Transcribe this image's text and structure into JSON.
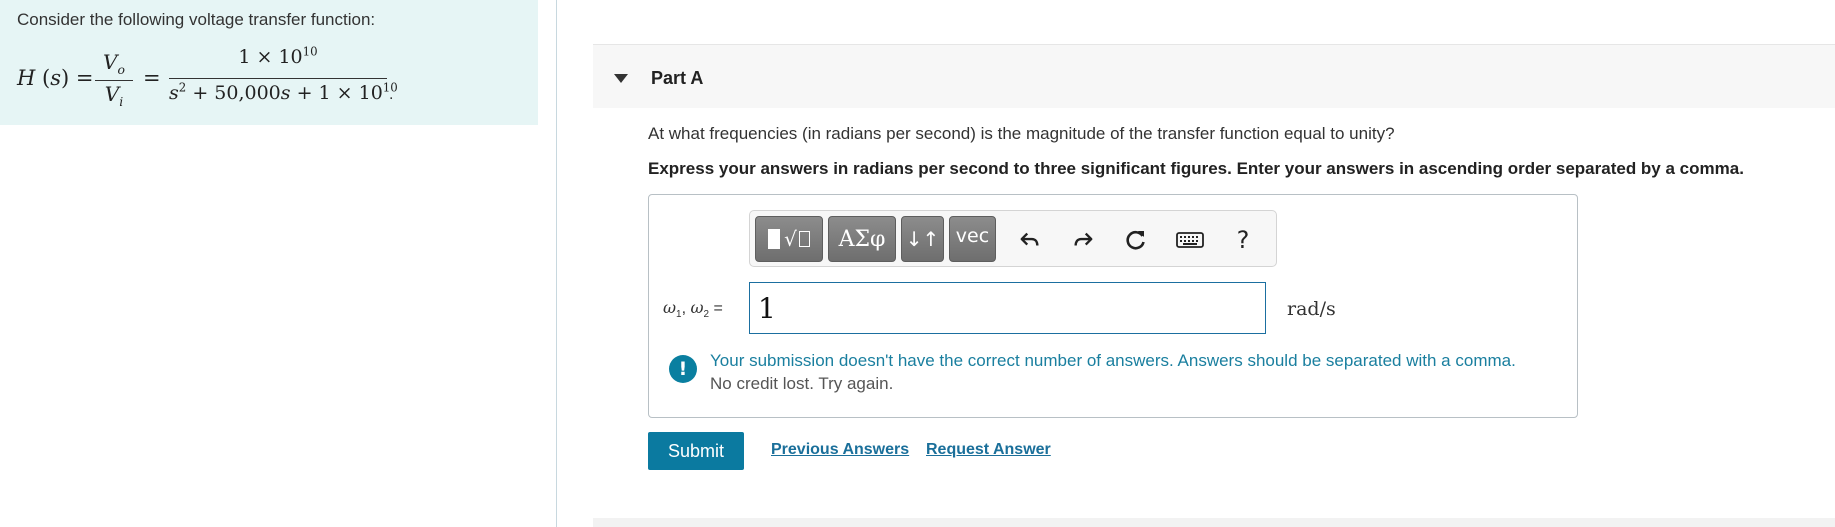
{
  "problem": {
    "intro": "Consider the following voltage transfer function:",
    "formula": {
      "lhs": "H (s) =",
      "frac1_num": "Vo",
      "frac1_den": "Vi",
      "equals": "=",
      "frac2_num": "1 × 10^10",
      "frac2_den": "s^2 + 50,000s + 1 × 10^10",
      "end": "."
    }
  },
  "part": {
    "title": "Part A",
    "question": "At what frequencies (in radians per second) is the magnitude of the transfer function equal to unity?",
    "instruction": "Express your answers in radians per second to three significant figures. Enter your answers in ascending order separated by a comma."
  },
  "toolbar": {
    "greek_label": "ΑΣφ",
    "sub_label": "↓↑",
    "vec_label": "vec",
    "help_label": "?"
  },
  "answer": {
    "label": "ω1, ω2 =",
    "value": "1",
    "unit": "rad/s"
  },
  "feedback": {
    "icon": "!",
    "message": "Your submission doesn't have the correct number of answers. Answers should be separated with a comma.",
    "sub": "No credit lost. Try again."
  },
  "actions": {
    "submit": "Submit",
    "previous_answers": "Previous Answers",
    "request_answer": "Request Answer"
  },
  "colors": {
    "panel_bg": "#e6f5f5",
    "accent": "#0b7aa0",
    "link": "#1a6f9a",
    "feedback_text": "#1a7f9f"
  }
}
